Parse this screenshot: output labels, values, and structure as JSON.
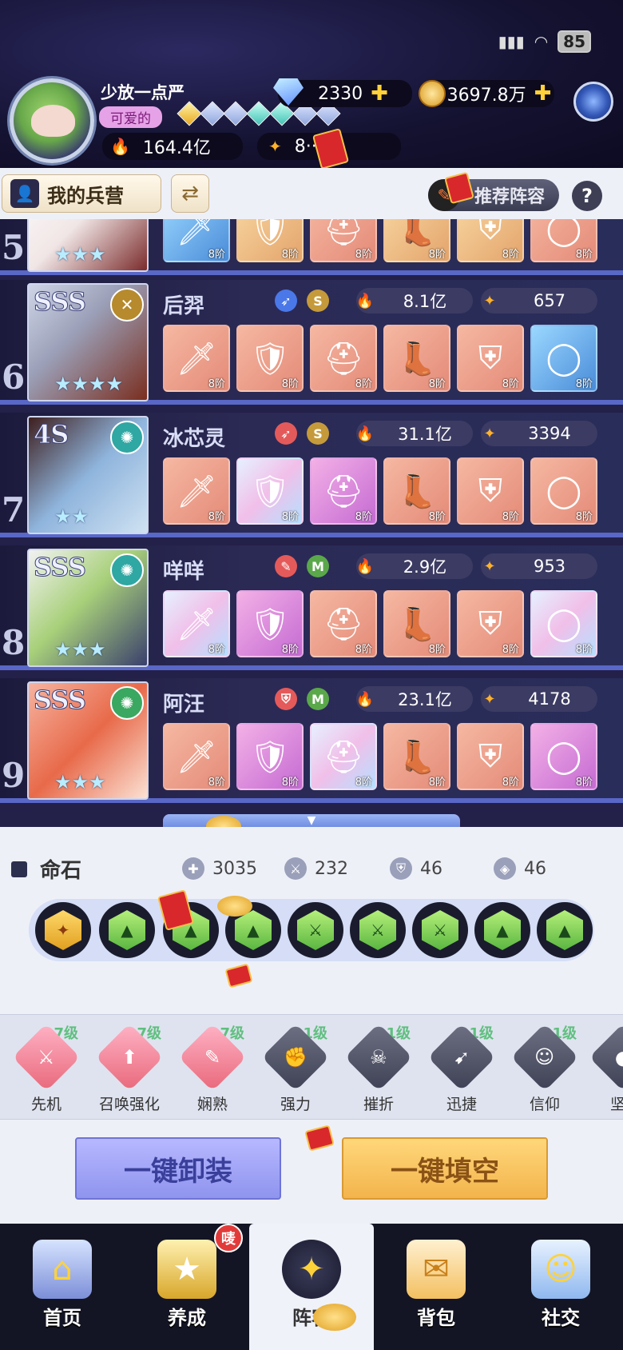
{
  "status": {
    "battery": "85"
  },
  "player": {
    "name": "少放一点严",
    "tag": "可爱的",
    "gems": "2330",
    "gold": "3697.8万",
    "power": "164.4亿",
    "score": "8··68"
  },
  "tabs": {
    "barracks": "我的兵营",
    "recommend": "推荐阵容",
    "help": "?"
  },
  "heroes": [
    {
      "index": "5",
      "rank": "",
      "name": "",
      "power": "",
      "score": "",
      "cls2": "",
      "stars": 3,
      "level": "8阶"
    },
    {
      "index": "6",
      "rank": "SSS",
      "name": "后羿",
      "cls2": "S",
      "power": "8.1亿",
      "score": "657",
      "stars": 4,
      "level": "8阶"
    },
    {
      "index": "7",
      "rank": "4S",
      "name": "冰芯灵",
      "cls2": "S",
      "power": "31.1亿",
      "score": "3394",
      "stars": 2,
      "level": "8阶"
    },
    {
      "index": "8",
      "rank": "SSS",
      "name": "咩咩",
      "cls2": "M",
      "power": "2.9亿",
      "score": "953",
      "stars": 3,
      "level": "8阶"
    },
    {
      "index": "9",
      "rank": "SSS",
      "name": "阿汪",
      "cls2": "M",
      "power": "23.1亿",
      "score": "4178",
      "stars": 3,
      "level": "8阶"
    }
  ],
  "fate": {
    "title": "命石",
    "hp": "3035",
    "atk": "232",
    "def": "46",
    "res": "46"
  },
  "skills": [
    {
      "name": "先机",
      "level": "7级"
    },
    {
      "name": "召唤强化",
      "level": "7级"
    },
    {
      "name": "娴熟",
      "level": "7级"
    },
    {
      "name": "强力",
      "level": "1级"
    },
    {
      "name": "摧折",
      "level": "1级"
    },
    {
      "name": "迅捷",
      "level": "1级"
    },
    {
      "name": "信仰",
      "level": "1级"
    },
    {
      "name": "坚",
      "level": ""
    }
  ],
  "buttons": {
    "unload": "一键卸装",
    "fill": "一键填空"
  },
  "nav": [
    {
      "label": "首页",
      "icon": "home-icon"
    },
    {
      "label": "养成",
      "icon": "star-upgrade-icon",
      "badge": "唛"
    },
    {
      "label": "阵容",
      "icon": "formation-icon"
    },
    {
      "label": "背包",
      "icon": "bag-icon"
    },
    {
      "label": "社交",
      "icon": "social-icon"
    }
  ],
  "colors": {
    "accent": "#5967c7",
    "gold": "#f3b44c",
    "purple": "#8f94ee"
  }
}
